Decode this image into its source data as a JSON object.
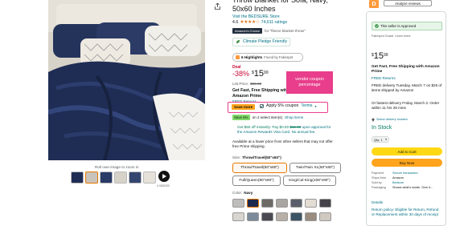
{
  "product": {
    "title": "Throw Blanket for Sofa, Navy, 50x60 Inches",
    "store_link": "Visit the BEDSURE Store",
    "rating_value": "4.6",
    "ratings_count": "74,611 ratings",
    "badge_label": "Amazon's Choice",
    "badge_for": "for \"fleece blanket throw\"",
    "climate_label": "Climate Pledge Friendly",
    "highlights_label": "6 Highlights",
    "highlights_source": "Found by Fakespot",
    "deal_label": "Deal",
    "discount": "-38%",
    "price_symbol": "$",
    "price_whole": "15",
    "price_fraction": "99",
    "list_price_label": "List Price:",
    "list_price": "$25.99",
    "shipping_line": "Get Fast, Free Shipping with Amazon Prime",
    "returns_label": "FREE Returns",
    "save_more_label": "Save more",
    "coupon_label": "Apply 5% coupon",
    "terms_label": "Terms",
    "save_5_label": "Save 5%",
    "save_5_text": "on 2 select item(s)",
    "shop_items_label": "Shop items",
    "card_offer_prefix": "Get $50 off instantly: Pay",
    "card_offer_price": "$0.00",
    "card_offer_strike": "$15.99",
    "card_offer_suffix": "upon approval for the Amazon Rewards Visa Card. No annual fee.",
    "lower_price_text": "Available at a lower price from other sellers that may not offer free Prime shipping.",
    "size_label": "Size:",
    "size_value": "Throw/Travel(50\"x60\")",
    "sizes": [
      "Throw/Travel(50\"x60\")",
      "Twin/Twin XL(60\"x80\")",
      "Full/Queen(90\"x90\")",
      "King/Cal King(108\"x90\")"
    ],
    "color_label": "Color:",
    "color_value": "Navy",
    "image_caption": "Roll over image to zoom in",
    "videos_label": "4 VIDEOS"
  },
  "annotation": {
    "text": "vendor coupon percentage",
    "color": "#e83e8c"
  },
  "fakespot": {
    "grade": "D",
    "analyze_label": "Analyze reviews",
    "seller_approved": "This seller is Approved",
    "passport": "Fakespot Guard",
    "learn_more": "Learn more"
  },
  "buybox": {
    "price_symbol": "$",
    "price_whole": "15",
    "price_fraction": "99",
    "shipping": "Get Fast, Free Shipping with Amazon Prime",
    "returns": "FREE Returns",
    "delivery": "FREE delivery Tuesday, March 7 on $25 of items shipped by Amazon",
    "fastest": "Or fastest delivery Friday, March 3. Order within 11 hrs 29 mins",
    "location": "Select delivery location",
    "stock": "In Stock",
    "qty": "Qty: 1",
    "add_to_cart": "Add to Cart",
    "buy_now": "Buy Now",
    "details": [
      {
        "label": "Payment",
        "value": "Secure transaction"
      },
      {
        "label": "Ships from",
        "value": "Amazon"
      },
      {
        "label": "Sold by",
        "value": "Bedsure"
      },
      {
        "label": "Packaging",
        "value": "Shows what's inside. Give it..."
      }
    ],
    "details_link": "Details",
    "return_policy": "Return policy: Eligible for Return, Refund or Replacement within 30 days of receipt"
  },
  "colors": {
    "accent_yellow": "#ffd814",
    "accent_orange": "#ffa41c",
    "fakespot_orange": "#ff9a3c",
    "navy": "#1d2a4d",
    "teal": "#007185",
    "deal_red": "#cc0c39",
    "prime_green": "#067d62"
  }
}
